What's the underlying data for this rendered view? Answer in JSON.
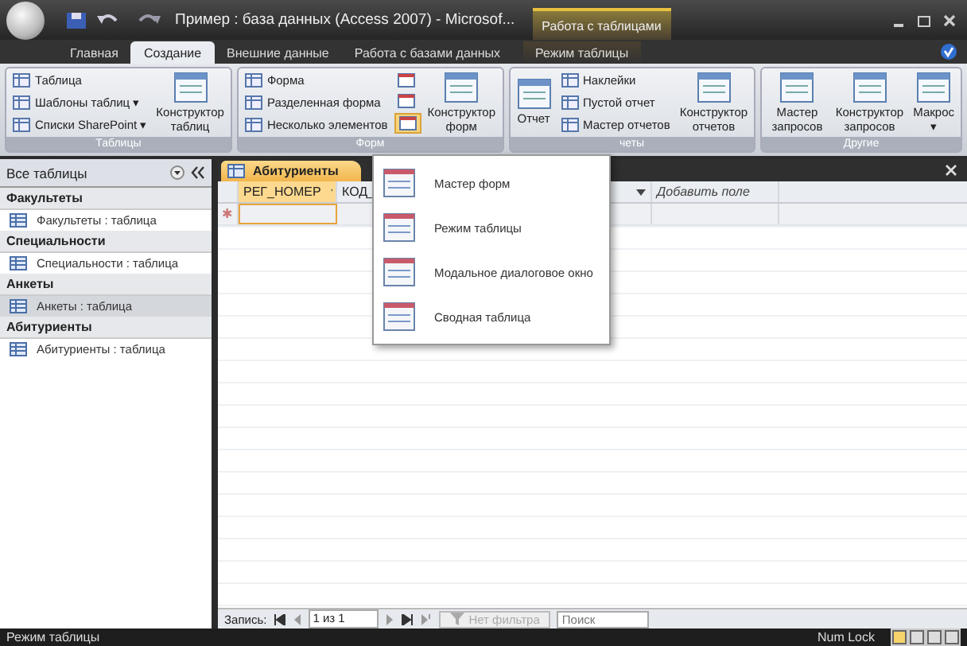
{
  "window": {
    "title": "Пример : база данных (Access 2007) - Microsof...",
    "context_tab": "Работа с таблицами"
  },
  "tabs": [
    {
      "label": "Главная",
      "selected": false
    },
    {
      "label": "Создание",
      "selected": true
    },
    {
      "label": "Внешние данные",
      "selected": false
    },
    {
      "label": "Работа с базами данных",
      "selected": false
    },
    {
      "label": "Режим таблицы",
      "selected": false
    }
  ],
  "ribbon": [
    {
      "label": "Таблицы",
      "columns": [
        {
          "kind": "small",
          "items": [
            "Таблица",
            "Шаблоны таблиц ▾",
            "Списки SharePoint ▾"
          ]
        },
        {
          "kind": "large",
          "items": [
            "Конструктор таблиц"
          ]
        }
      ]
    },
    {
      "label": "Форм",
      "columns": [
        {
          "kind": "small",
          "items": [
            "Форма",
            "Разделенная форма",
            "Несколько элементов"
          ]
        },
        {
          "kind": "icons",
          "items": [
            {
              "expanded": false
            },
            {
              "expanded": false
            },
            {
              "expanded": true
            }
          ]
        },
        {
          "kind": "large",
          "items": [
            "Конструктор форм"
          ]
        }
      ]
    },
    {
      "label": "четы",
      "columns": [
        {
          "kind": "large",
          "items": [
            "Отчет"
          ]
        },
        {
          "kind": "small",
          "items": [
            "Наклейки",
            "Пустой отчет",
            "Мастер отчетов"
          ]
        },
        {
          "kind": "large",
          "items": [
            "Конструктор отчетов"
          ]
        }
      ]
    },
    {
      "label": "Другие",
      "columns": [
        {
          "kind": "large",
          "items": [
            "Мастер запросов"
          ]
        },
        {
          "kind": "large",
          "items": [
            "Конструктор запросов"
          ]
        },
        {
          "kind": "large",
          "items": [
            "Макрос ▾"
          ]
        }
      ]
    }
  ],
  "sidebar": {
    "title": "Все таблицы",
    "groups": [
      {
        "heading": "Факультеты",
        "items": [
          {
            "label": "Факультеты : таблица",
            "selected": false
          }
        ]
      },
      {
        "heading": "Специальности",
        "items": [
          {
            "label": "Специальности : таблица",
            "selected": false
          }
        ]
      },
      {
        "heading": "Анкеты",
        "items": [
          {
            "label": "Анкеты : таблица",
            "selected": true
          }
        ]
      },
      {
        "heading": "Абитуриенты",
        "items": [
          {
            "label": "Абитуриенты : таблица",
            "selected": false
          }
        ]
      }
    ]
  },
  "document": {
    "tab": "Абитуриенты",
    "columns": [
      {
        "label": "РЕГ_НОМЕР",
        "dropdown": true
      },
      {
        "label": "КОД_"
      },
      {
        "dropdown": true
      },
      {
        "label": "Добавить поле",
        "dropdown": false
      }
    ],
    "new_row_marker": "✱"
  },
  "menu": {
    "items": [
      "Мастер форм",
      "Режим таблицы",
      "Модальное диалоговое окно",
      "Сводная таблица"
    ]
  },
  "navigation": {
    "label": "Запись:",
    "position": "1 из 1",
    "filter": {
      "label": "Нет фильтра",
      "disabled": true
    },
    "search_placeholder": "Поиск"
  },
  "status_bar": {
    "mode": "Режим таблицы",
    "indicator": "Num Lock"
  }
}
